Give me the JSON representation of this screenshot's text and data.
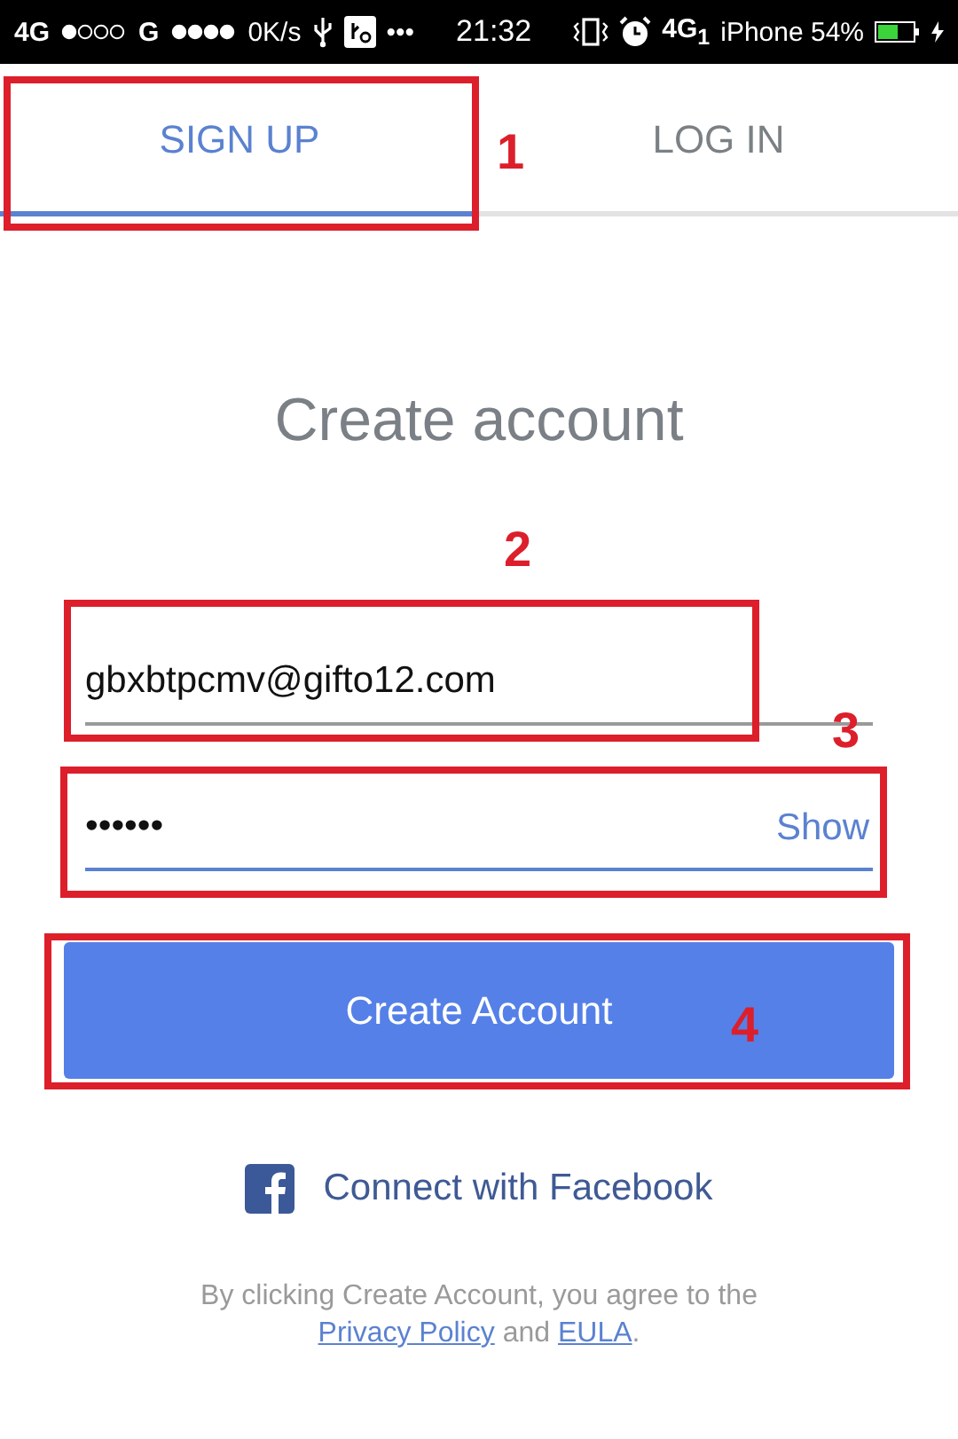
{
  "status_bar": {
    "network_1": "4G",
    "network_2": "G",
    "speed": "0K/s",
    "more": "•••",
    "time": "21:32",
    "network_3": "4G$_{1}$",
    "carrier_battery": "iPhone 54%"
  },
  "tabs": [
    {
      "label": "SIGN UP",
      "selected": true
    },
    {
      "label": "LOG IN",
      "selected": false
    }
  ],
  "title": "Create account",
  "email_field": {
    "value": "gbxbtpcmv@gifto12.com",
    "focused": false
  },
  "password_field": {
    "value": "••••••",
    "focused": true,
    "toggle": "Show"
  },
  "create_button": "Create Account",
  "facebook_link": "Connect with Facebook",
  "legal": {
    "text": "By clicking Create Account, you agree to the",
    "privacy_link": "Privacy Policy",
    "and": "and",
    "eula_link": "EULA",
    "end": "."
  },
  "annotations": [
    {
      "label": "1"
    },
    {
      "label": "2"
    },
    {
      "label": "3"
    },
    {
      "label": "4"
    }
  ]
}
